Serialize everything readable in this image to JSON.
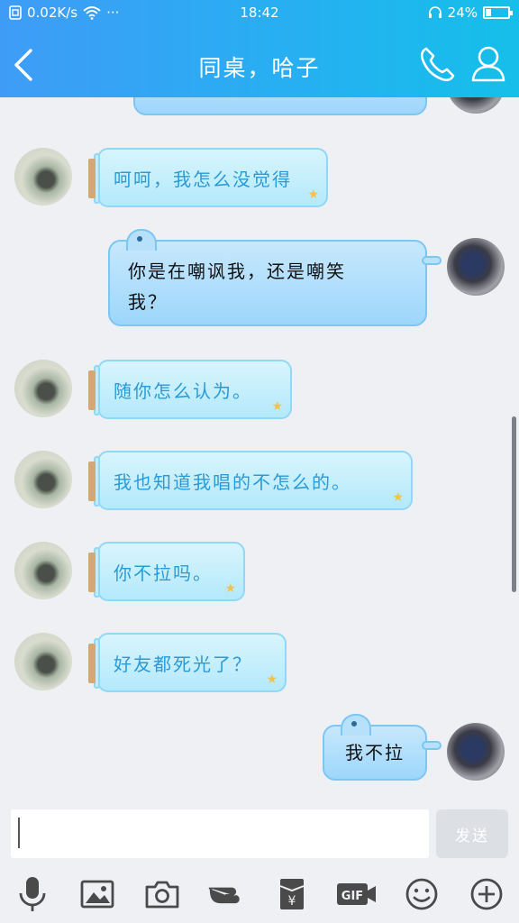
{
  "status_bar": {
    "speed": "0.02K/s",
    "dots": "···",
    "time": "18:42",
    "battery": "24%",
    "battery_level": 0.24
  },
  "header": {
    "title": "同桌，哈子"
  },
  "messages": [
    {
      "side": "in",
      "text": "呵呵，我怎么没觉得"
    },
    {
      "side": "out",
      "line1": "你是在嘲讽我，还是嘲笑",
      "line2": "我？"
    },
    {
      "side": "in",
      "text": "随你怎么认为。"
    },
    {
      "side": "in",
      "text": "我也知道我唱的不怎么的。"
    },
    {
      "side": "in",
      "text": "你不拉吗。"
    },
    {
      "side": "in",
      "text": "好友都死光了？"
    },
    {
      "side": "out",
      "text": "我不拉"
    }
  ],
  "input": {
    "send_label": "发送"
  },
  "toolbar": {
    "gif_label": "GIF",
    "yen_label": "¥"
  }
}
